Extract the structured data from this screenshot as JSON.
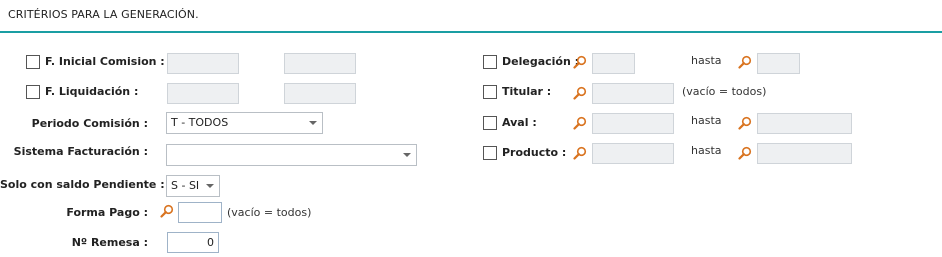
{
  "header": {
    "title": "CRITÉRIOS PARA LA GENERACIÓN."
  },
  "left": {
    "f_inicial_label": "F. Inicial Comision :",
    "f_liquidacion_label": "F. Liquidación :",
    "periodo_label": "Periodo Comisión :",
    "periodo_value": "T - TODOS",
    "sistema_label": "Sistema Facturación :",
    "sistema_value": "",
    "saldo_label": "Solo con saldo Pendiente :",
    "saldo_value": "S - SI",
    "forma_pago_label": "Forma Pago :",
    "forma_pago_hint": "(vacío = todos)",
    "remesa_label": "Nº Remesa :",
    "remesa_value": "0"
  },
  "right": {
    "delegacion_label": "Delegación :",
    "titular_label": "Titular :",
    "titular_hint": "(vacío = todos)",
    "aval_label": "Aval :",
    "producto_label": "Producto :",
    "hasta_label": "hasta"
  },
  "colors": {
    "accent": "#1a9ea3",
    "search_icon": "#d9731f"
  }
}
